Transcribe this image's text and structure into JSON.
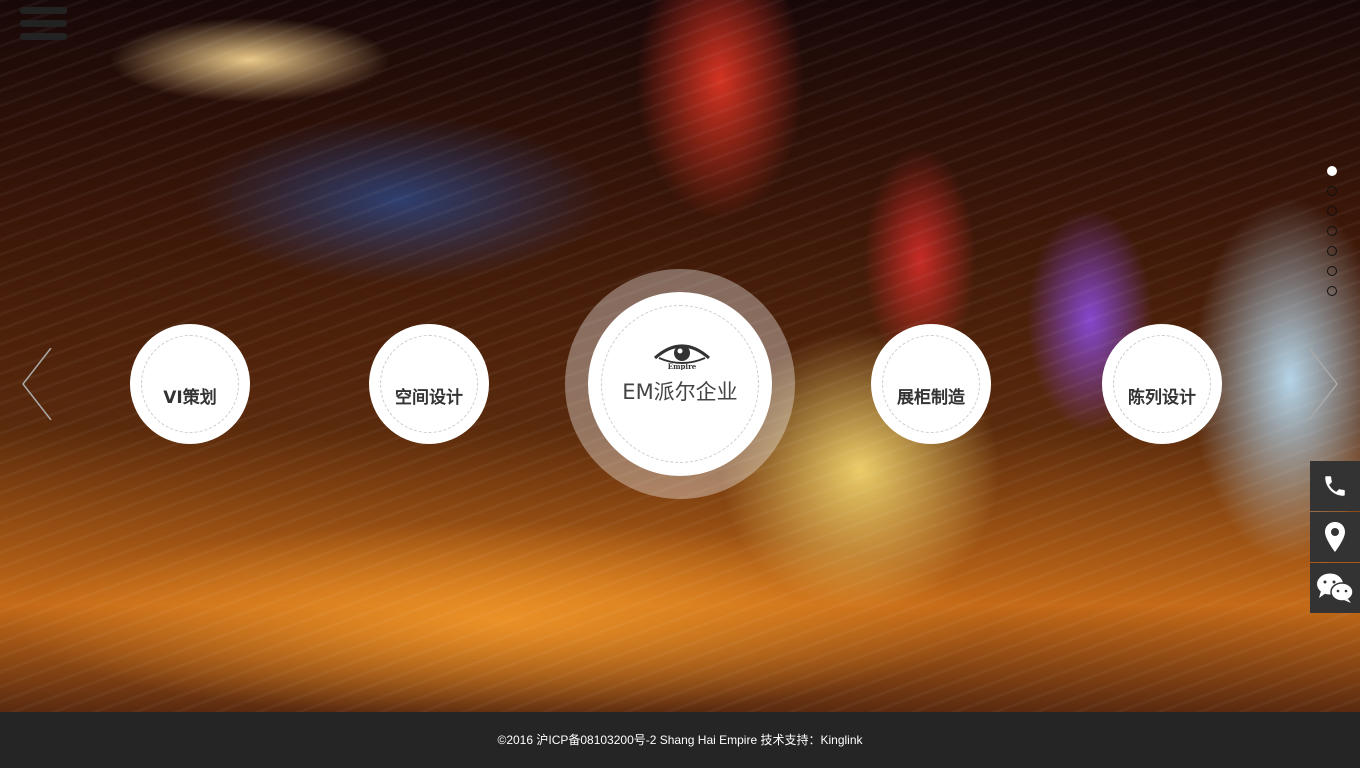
{
  "nav": {
    "menu_icon": "hamburger-icon"
  },
  "carousel": {
    "items": [
      {
        "label": "VI策划"
      },
      {
        "label": "空间设计"
      },
      {
        "label": "展柜制造"
      },
      {
        "label": "陈列设计"
      }
    ],
    "center": {
      "logo_text": "Empire",
      "label": "EM派尔企业"
    },
    "pagination": {
      "count": 7,
      "active": 1
    }
  },
  "side_tools": [
    {
      "icon": "phone-icon"
    },
    {
      "icon": "location-pin-icon"
    },
    {
      "icon": "wechat-icon"
    }
  ],
  "footer": {
    "text": "©2016  沪ICP备08103200号-2 Shang  Hai  Empire  技术支持：Kinglink"
  }
}
